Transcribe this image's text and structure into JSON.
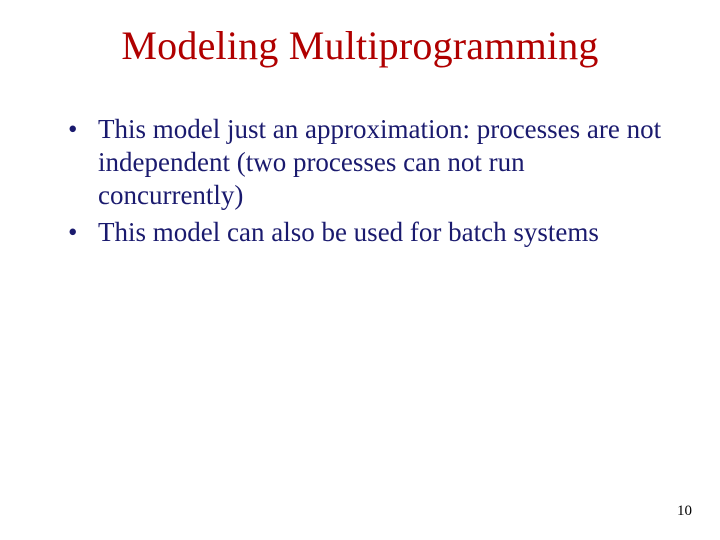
{
  "title": "Modeling Multiprogramming",
  "bullets": [
    "This model just an approximation: processes are not independent (two processes can not run concurrently)",
    "This model can also be used for batch systems"
  ],
  "page_number": "10"
}
